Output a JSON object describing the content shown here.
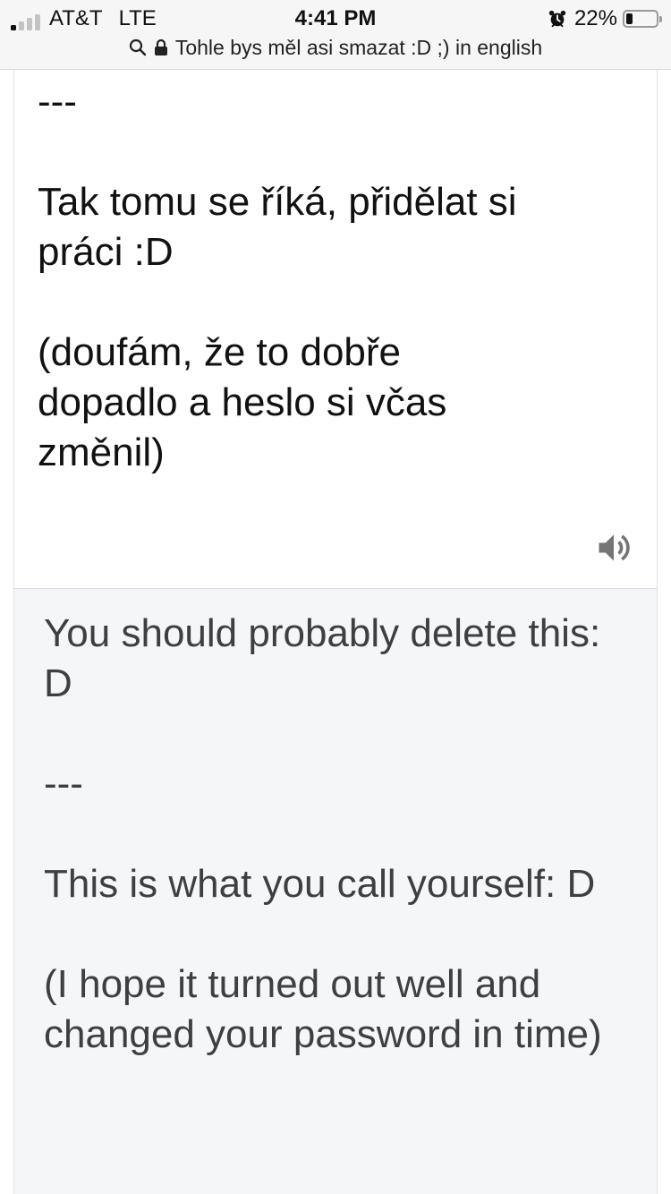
{
  "status_bar": {
    "carrier": "AT&T",
    "network": "LTE",
    "time": "4:41 PM",
    "battery": "22%",
    "battery_level": 0.22,
    "signal_bars": 1
  },
  "address_bar": {
    "query": "Tohle bys měl asi smazat :D ;) in english"
  },
  "translation": {
    "source_text": "---\n\nTak tomu se říká, přidělat si práci :D\n\n(doufám, že to dobře dopadlo a heslo si včas změnil)",
    "target_text": "You should probably delete this: D\n\n---\n\nThis is what you call yourself: D\n\n(I hope it turned out well and changed your password in time)"
  },
  "icons": {
    "search": "search-icon",
    "lock": "lock-icon",
    "alarm": "alarm-icon",
    "battery": "battery-icon",
    "speaker": "speaker-icon"
  },
  "colors": {
    "status_bar_bg": "#f6f6f6",
    "target_card_bg": "#f5f6f8",
    "speaker_gray": "#757575",
    "target_text": "#3c4043"
  }
}
